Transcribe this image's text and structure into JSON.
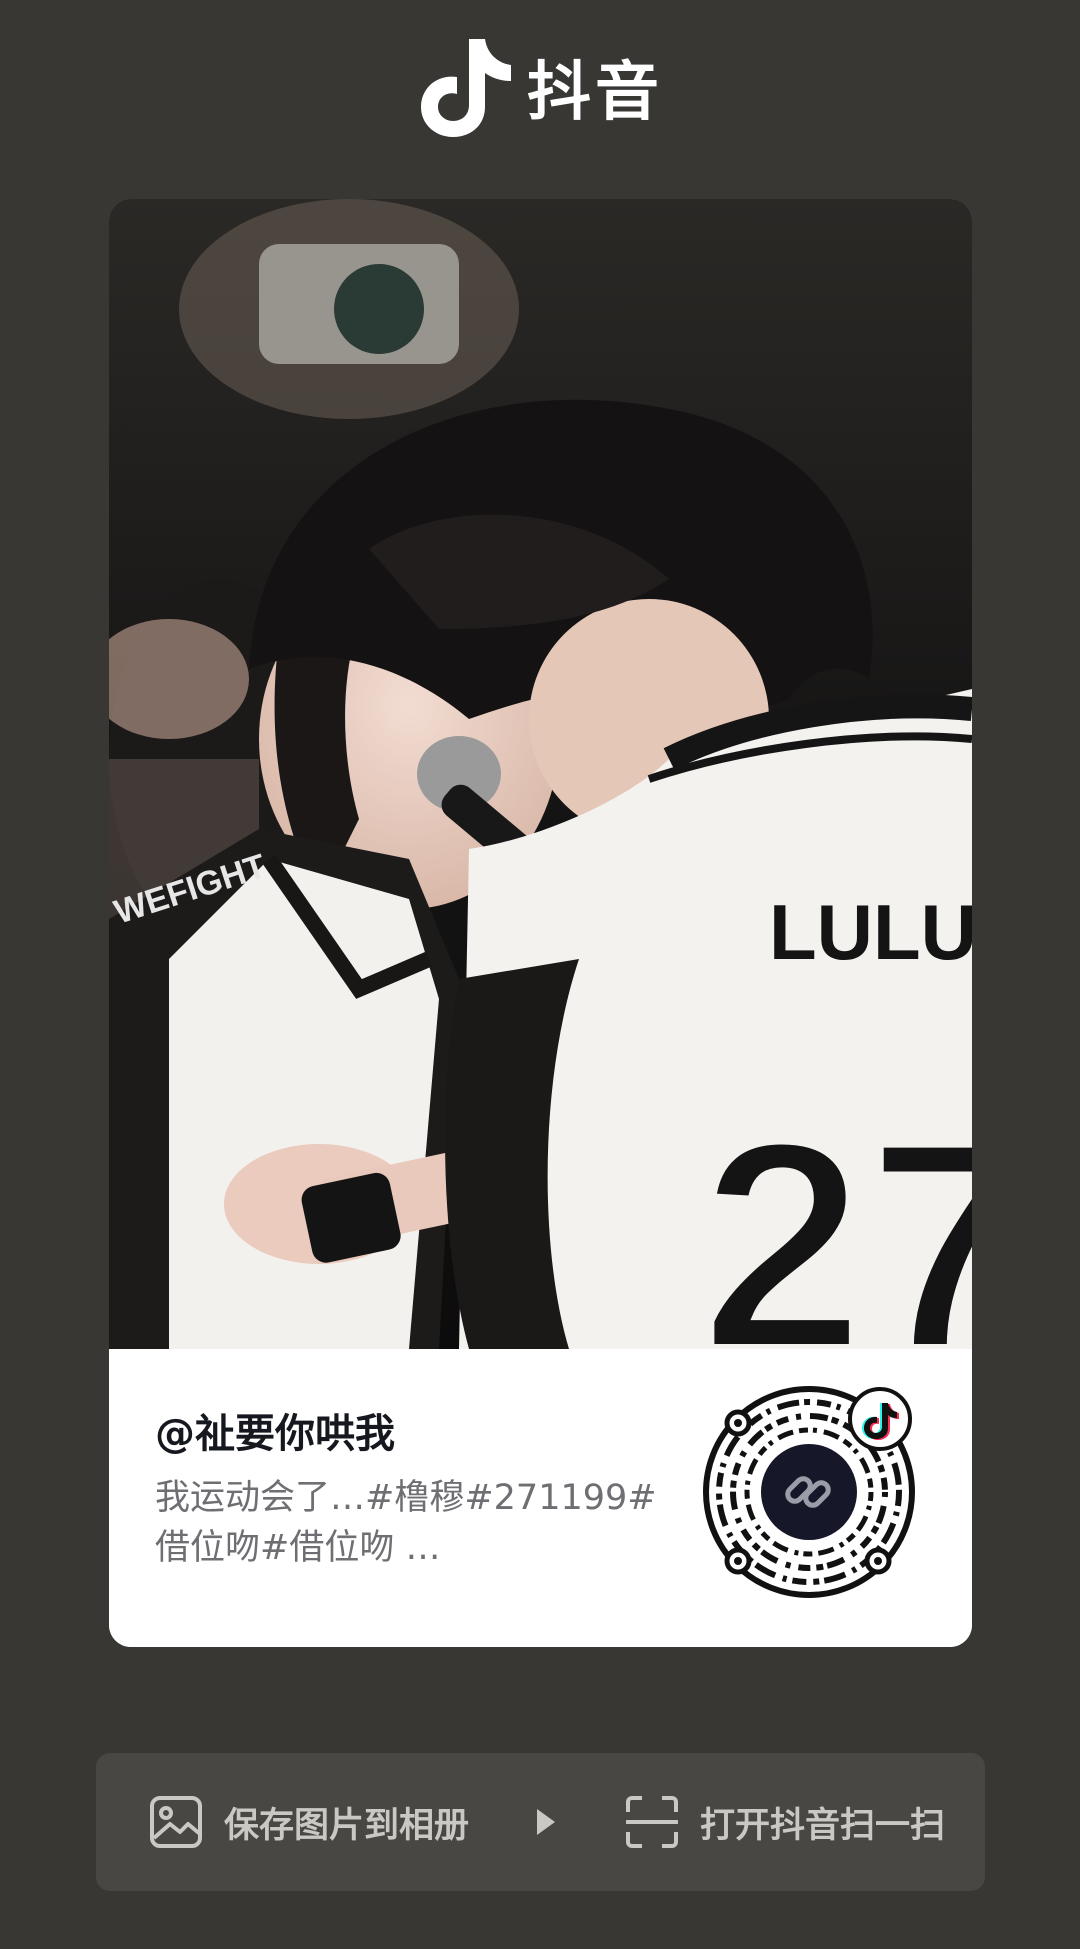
{
  "app": {
    "name": "抖音",
    "logo_icon": "douyin-note-icon"
  },
  "post": {
    "username": "@祉要你哄我",
    "description": "我运动会了…#橹穆#271199#借位吻#借位吻 …",
    "jersey_name": "LULU",
    "jersey_number": "27",
    "qr_icon": "link-icon"
  },
  "actions": {
    "save_label": "保存图片到相册",
    "save_icon": "image-icon",
    "scan_label": "打开抖音扫一扫",
    "scan_icon": "scan-icon",
    "separator_icon": "triangle-right-icon"
  },
  "colors": {
    "background": "#383734",
    "card": "#ffffff",
    "action_bar": "#484744",
    "accent_cyan": "#25f4ee",
    "accent_red": "#fe2c55"
  }
}
